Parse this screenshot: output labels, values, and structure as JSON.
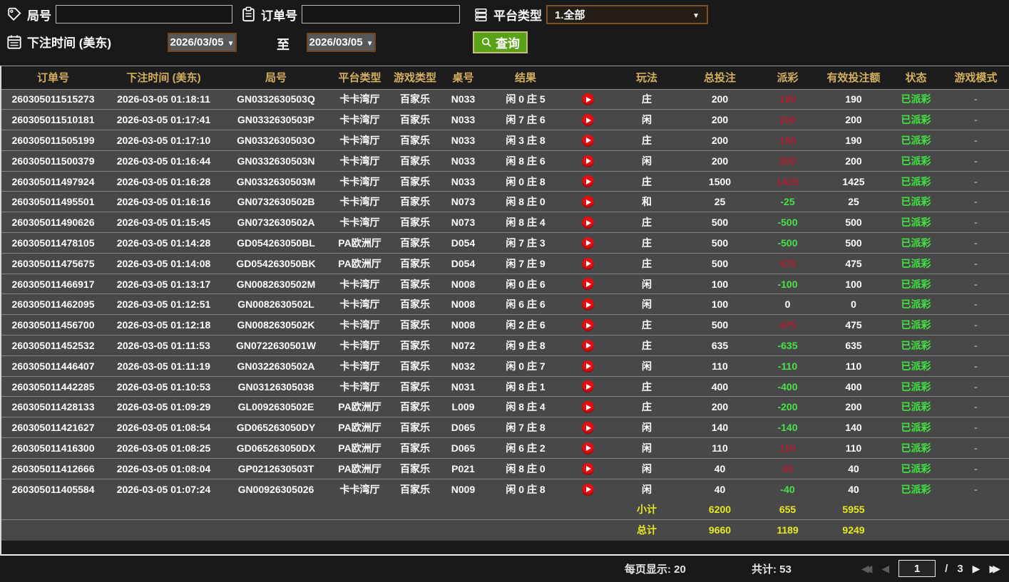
{
  "filters": {
    "round": {
      "label": "局号",
      "value": "",
      "icon": "tag-icon"
    },
    "order": {
      "label": "订单号",
      "value": "",
      "icon": "clipboard-icon"
    },
    "platform": {
      "label": "平台类型",
      "value": "1.全部",
      "icon": "server-icon"
    },
    "bet_time": {
      "label": "下注时间 (美东)",
      "icon": "calendar-icon",
      "from": "2026/03/05",
      "to": "2026/03/05",
      "to_label": "至"
    },
    "query_label": "查询",
    "query_icon": "search-icon"
  },
  "table": {
    "columns": [
      "订单号",
      "下注时间 (美东)",
      "局号",
      "平台类型",
      "游戏类型",
      "桌号",
      "结果",
      "",
      "玩法",
      "总投注",
      "派彩",
      "有效投注额",
      "状态",
      "游戏模式"
    ],
    "row_play_icon": "play-video-icon",
    "rows": [
      {
        "order_no": "260305011515273",
        "bet_time": "2026-03-05 01:18:11",
        "round_no": "GN0332630503Q",
        "platform": "卡卡湾厅",
        "game_type": "百家乐",
        "table_no": "N033",
        "result": "闲 0 庄 5",
        "play": "庄",
        "total_bet": "200",
        "payout": "190",
        "payout_color": "red",
        "valid_bet": "190",
        "status": "已派彩",
        "mode": "-"
      },
      {
        "order_no": "260305011510181",
        "bet_time": "2026-03-05 01:17:41",
        "round_no": "GN0332630503P",
        "platform": "卡卡湾厅",
        "game_type": "百家乐",
        "table_no": "N033",
        "result": "闲 7 庄 6",
        "play": "闲",
        "total_bet": "200",
        "payout": "200",
        "payout_color": "red",
        "valid_bet": "200",
        "status": "已派彩",
        "mode": "-"
      },
      {
        "order_no": "260305011505199",
        "bet_time": "2026-03-05 01:17:10",
        "round_no": "GN0332630503O",
        "platform": "卡卡湾厅",
        "game_type": "百家乐",
        "table_no": "N033",
        "result": "闲 3 庄 8",
        "play": "庄",
        "total_bet": "200",
        "payout": "190",
        "payout_color": "red",
        "valid_bet": "190",
        "status": "已派彩",
        "mode": "-"
      },
      {
        "order_no": "260305011500379",
        "bet_time": "2026-03-05 01:16:44",
        "round_no": "GN0332630503N",
        "platform": "卡卡湾厅",
        "game_type": "百家乐",
        "table_no": "N033",
        "result": "闲 8 庄 6",
        "play": "闲",
        "total_bet": "200",
        "payout": "200",
        "payout_color": "red",
        "valid_bet": "200",
        "status": "已派彩",
        "mode": "-"
      },
      {
        "order_no": "260305011497924",
        "bet_time": "2026-03-05 01:16:28",
        "round_no": "GN0332630503M",
        "platform": "卡卡湾厅",
        "game_type": "百家乐",
        "table_no": "N033",
        "result": "闲 0 庄 8",
        "play": "庄",
        "total_bet": "1500",
        "payout": "1425",
        "payout_color": "red",
        "valid_bet": "1425",
        "status": "已派彩",
        "mode": "-"
      },
      {
        "order_no": "260305011495501",
        "bet_time": "2026-03-05 01:16:16",
        "round_no": "GN0732630502B",
        "platform": "卡卡湾厅",
        "game_type": "百家乐",
        "table_no": "N073",
        "result": "闲 8 庄 0",
        "play": "和",
        "total_bet": "25",
        "payout": "-25",
        "payout_color": "green",
        "valid_bet": "25",
        "status": "已派彩",
        "mode": "-"
      },
      {
        "order_no": "260305011490626",
        "bet_time": "2026-03-05 01:15:45",
        "round_no": "GN0732630502A",
        "platform": "卡卡湾厅",
        "game_type": "百家乐",
        "table_no": "N073",
        "result": "闲 8 庄 4",
        "play": "庄",
        "total_bet": "500",
        "payout": "-500",
        "payout_color": "green",
        "valid_bet": "500",
        "status": "已派彩",
        "mode": "-"
      },
      {
        "order_no": "260305011478105",
        "bet_time": "2026-03-05 01:14:28",
        "round_no": "GD054263050BL",
        "platform": "PA欧洲厅",
        "game_type": "百家乐",
        "table_no": "D054",
        "result": "闲 7 庄 3",
        "play": "庄",
        "total_bet": "500",
        "payout": "-500",
        "payout_color": "green",
        "valid_bet": "500",
        "status": "已派彩",
        "mode": "-"
      },
      {
        "order_no": "260305011475675",
        "bet_time": "2026-03-05 01:14:08",
        "round_no": "GD054263050BK",
        "platform": "PA欧洲厅",
        "game_type": "百家乐",
        "table_no": "D054",
        "result": "闲 7 庄 9",
        "play": "庄",
        "total_bet": "500",
        "payout": "475",
        "payout_color": "red",
        "valid_bet": "475",
        "status": "已派彩",
        "mode": "-"
      },
      {
        "order_no": "260305011466917",
        "bet_time": "2026-03-05 01:13:17",
        "round_no": "GN0082630502M",
        "platform": "卡卡湾厅",
        "game_type": "百家乐",
        "table_no": "N008",
        "result": "闲 0 庄 6",
        "play": "闲",
        "total_bet": "100",
        "payout": "-100",
        "payout_color": "green",
        "valid_bet": "100",
        "status": "已派彩",
        "mode": "-"
      },
      {
        "order_no": "260305011462095",
        "bet_time": "2026-03-05 01:12:51",
        "round_no": "GN0082630502L",
        "platform": "卡卡湾厅",
        "game_type": "百家乐",
        "table_no": "N008",
        "result": "闲 6 庄 6",
        "play": "闲",
        "total_bet": "100",
        "payout": "0",
        "payout_color": "white",
        "valid_bet": "0",
        "status": "已派彩",
        "mode": "-"
      },
      {
        "order_no": "260305011456700",
        "bet_time": "2026-03-05 01:12:18",
        "round_no": "GN0082630502K",
        "platform": "卡卡湾厅",
        "game_type": "百家乐",
        "table_no": "N008",
        "result": "闲 2 庄 6",
        "play": "庄",
        "total_bet": "500",
        "payout": "475",
        "payout_color": "red",
        "valid_bet": "475",
        "status": "已派彩",
        "mode": "-"
      },
      {
        "order_no": "260305011452532",
        "bet_time": "2026-03-05 01:11:53",
        "round_no": "GN0722630501W",
        "platform": "卡卡湾厅",
        "game_type": "百家乐",
        "table_no": "N072",
        "result": "闲 9 庄 8",
        "play": "庄",
        "total_bet": "635",
        "payout": "-635",
        "payout_color": "green",
        "valid_bet": "635",
        "status": "已派彩",
        "mode": "-"
      },
      {
        "order_no": "260305011446407",
        "bet_time": "2026-03-05 01:11:19",
        "round_no": "GN0322630502A",
        "platform": "卡卡湾厅",
        "game_type": "百家乐",
        "table_no": "N032",
        "result": "闲 0 庄 7",
        "play": "闲",
        "total_bet": "110",
        "payout": "-110",
        "payout_color": "green",
        "valid_bet": "110",
        "status": "已派彩",
        "mode": "-"
      },
      {
        "order_no": "260305011442285",
        "bet_time": "2026-03-05 01:10:53",
        "round_no": "GN03126305038",
        "platform": "卡卡湾厅",
        "game_type": "百家乐",
        "table_no": "N031",
        "result": "闲 8 庄 1",
        "play": "庄",
        "total_bet": "400",
        "payout": "-400",
        "payout_color": "green",
        "valid_bet": "400",
        "status": "已派彩",
        "mode": "-"
      },
      {
        "order_no": "260305011428133",
        "bet_time": "2026-03-05 01:09:29",
        "round_no": "GL0092630502E",
        "platform": "PA欧洲厅",
        "game_type": "百家乐",
        "table_no": "L009",
        "result": "闲 8 庄 4",
        "play": "庄",
        "total_bet": "200",
        "payout": "-200",
        "payout_color": "green",
        "valid_bet": "200",
        "status": "已派彩",
        "mode": "-"
      },
      {
        "order_no": "260305011421627",
        "bet_time": "2026-03-05 01:08:54",
        "round_no": "GD065263050DY",
        "platform": "PA欧洲厅",
        "game_type": "百家乐",
        "table_no": "D065",
        "result": "闲 7 庄 8",
        "play": "闲",
        "total_bet": "140",
        "payout": "-140",
        "payout_color": "green",
        "valid_bet": "140",
        "status": "已派彩",
        "mode": "-"
      },
      {
        "order_no": "260305011416300",
        "bet_time": "2026-03-05 01:08:25",
        "round_no": "GD065263050DX",
        "platform": "PA欧洲厅",
        "game_type": "百家乐",
        "table_no": "D065",
        "result": "闲 6 庄 2",
        "play": "闲",
        "total_bet": "110",
        "payout": "110",
        "payout_color": "red",
        "valid_bet": "110",
        "status": "已派彩",
        "mode": "-"
      },
      {
        "order_no": "260305011412666",
        "bet_time": "2026-03-05 01:08:04",
        "round_no": "GP0212630503T",
        "platform": "PA欧洲厅",
        "game_type": "百家乐",
        "table_no": "P021",
        "result": "闲 8 庄 0",
        "play": "闲",
        "total_bet": "40",
        "payout": "40",
        "payout_color": "red",
        "valid_bet": "40",
        "status": "已派彩",
        "mode": "-"
      },
      {
        "order_no": "260305011405584",
        "bet_time": "2026-03-05 01:07:24",
        "round_no": "GN00926305026",
        "platform": "卡卡湾厅",
        "game_type": "百家乐",
        "table_no": "N009",
        "result": "闲 0 庄 8",
        "play": "闲",
        "total_bet": "40",
        "payout": "-40",
        "payout_color": "green",
        "valid_bet": "40",
        "status": "已派彩",
        "mode": "-"
      }
    ],
    "subtotal": {
      "label": "小计",
      "total_bet": "6200",
      "payout": "655",
      "valid_bet": "5955"
    },
    "grand_total": {
      "label": "总计",
      "total_bet": "9660",
      "payout": "1189",
      "valid_bet": "9249"
    }
  },
  "footer": {
    "page_size_label": "每页显示: 20",
    "total_count_label": "共计: 53",
    "current_page": "1",
    "page_sep": "/",
    "total_pages": "3"
  },
  "colors": {
    "header_text": "#d4af5e",
    "payout_positive": "#b01e33",
    "payout_negative": "#4be14b",
    "status_paid": "#3fe43f",
    "summary_text": "#e9e920",
    "query_button_bg": "#58a215",
    "play_button": "#e60f0f",
    "row_bg": "#484848",
    "page_bg": "#191919"
  }
}
